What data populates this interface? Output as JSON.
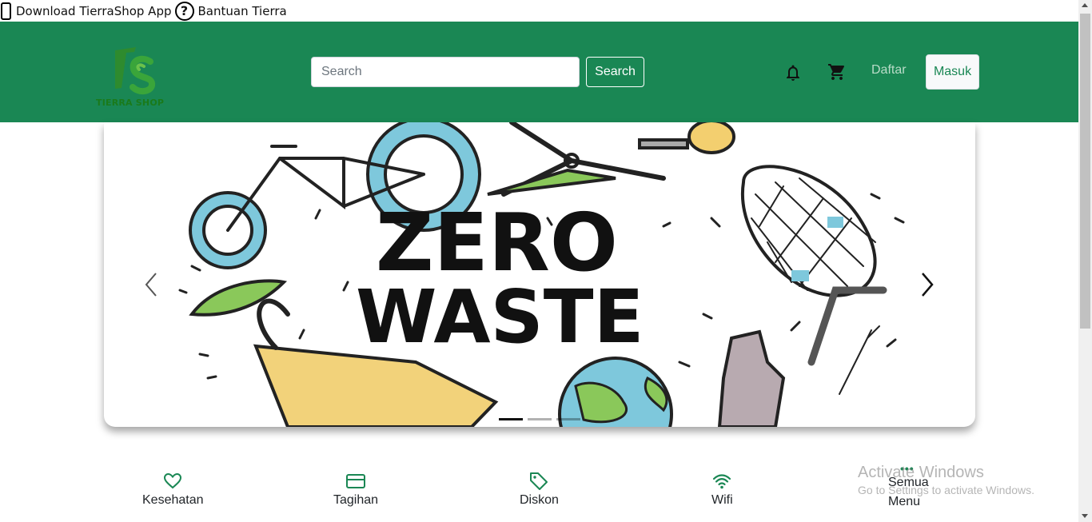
{
  "topbar": {
    "download_label": "Download TierraShop App",
    "help_label": "Bantuan Tierra"
  },
  "header": {
    "logo_text": "TIERRA SHOP",
    "search_placeholder": "Search",
    "search_button": "Search",
    "register_label": "Daftar",
    "login_label": "Masuk",
    "icons": [
      "bell-icon",
      "cart-icon"
    ]
  },
  "carousel": {
    "slide_text_line1": "ZERO",
    "slide_text_line2": "WASTE",
    "active_index": 0,
    "slide_count": 3
  },
  "categories": [
    {
      "label": "Kesehatan",
      "icon": "heart-icon"
    },
    {
      "label": "Tagihan",
      "icon": "credit-card-icon"
    },
    {
      "label": "Diskon",
      "icon": "tag-icon"
    },
    {
      "label": "Wifi",
      "icon": "wifi-icon"
    },
    {
      "label_line1": "Semua",
      "label_line2": "Menu",
      "icon": "more-dots-icon"
    }
  ],
  "watermark": {
    "title": "Activate Windows",
    "subtitle": "Go to Settings to activate Windows."
  },
  "colors": {
    "brand_green": "#1a8754",
    "white": "#ffffff"
  }
}
